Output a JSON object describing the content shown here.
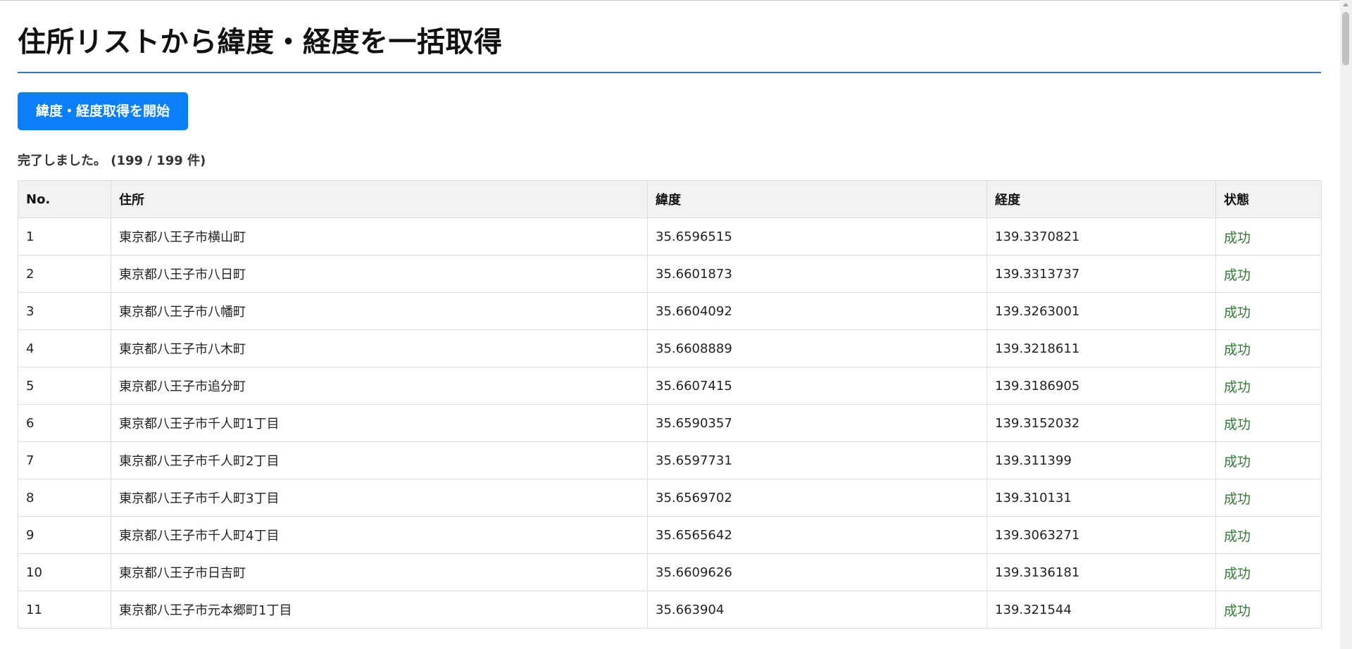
{
  "page": {
    "title": "住所リストから緯度・経度を一括取得",
    "start_button": "緯度・経度取得を開始",
    "status_text": "完了しました。 (199 / 199 件)"
  },
  "table": {
    "headers": [
      "No.",
      "住所",
      "緯度",
      "経度",
      "状態"
    ],
    "rows": [
      {
        "no": "1",
        "address": "東京都八王子市横山町",
        "lat": "35.6596515",
        "lng": "139.3370821",
        "status": "成功"
      },
      {
        "no": "2",
        "address": "東京都八王子市八日町",
        "lat": "35.6601873",
        "lng": "139.3313737",
        "status": "成功"
      },
      {
        "no": "3",
        "address": "東京都八王子市八幡町",
        "lat": "35.6604092",
        "lng": "139.3263001",
        "status": "成功"
      },
      {
        "no": "4",
        "address": "東京都八王子市八木町",
        "lat": "35.6608889",
        "lng": "139.3218611",
        "status": "成功"
      },
      {
        "no": "5",
        "address": "東京都八王子市追分町",
        "lat": "35.6607415",
        "lng": "139.3186905",
        "status": "成功"
      },
      {
        "no": "6",
        "address": "東京都八王子市千人町1丁目",
        "lat": "35.6590357",
        "lng": "139.3152032",
        "status": "成功"
      },
      {
        "no": "7",
        "address": "東京都八王子市千人町2丁目",
        "lat": "35.6597731",
        "lng": "139.311399",
        "status": "成功"
      },
      {
        "no": "8",
        "address": "東京都八王子市千人町3丁目",
        "lat": "35.6569702",
        "lng": "139.310131",
        "status": "成功"
      },
      {
        "no": "9",
        "address": "東京都八王子市千人町4丁目",
        "lat": "35.6565642",
        "lng": "139.3063271",
        "status": "成功"
      },
      {
        "no": "10",
        "address": "東京都八王子市日吉町",
        "lat": "35.6609626",
        "lng": "139.3136181",
        "status": "成功"
      },
      {
        "no": "11",
        "address": "東京都八王子市元本郷町1丁目",
        "lat": "35.663904",
        "lng": "139.321544",
        "status": "成功"
      }
    ]
  },
  "colors": {
    "accent": "#0a7ff7",
    "rule": "#1a7fd9",
    "success": "#2e7d32"
  }
}
